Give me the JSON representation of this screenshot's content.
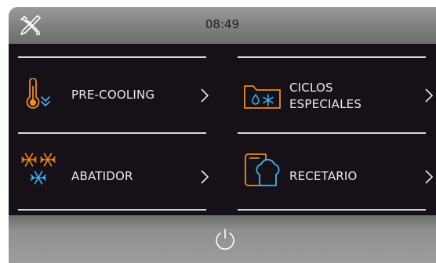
{
  "header": {
    "time": "08:49"
  },
  "menu": {
    "pre_cooling": "PRE-COOLING",
    "ciclos_line1": "CICLOS",
    "ciclos_line2": "ESPECIALES",
    "abatidor": "ABATIDOR",
    "recetario": "RECETARIO"
  },
  "icons": {
    "settings": "tools-icon",
    "pre_cooling": "thermometer-snow-icon",
    "ciclos": "folder-drop-snow-icon",
    "abatidor": "snowflakes-icon",
    "recetario": "chef-hat-book-icon",
    "chevron": "chevron-right-icon",
    "power": "power-icon"
  },
  "colors": {
    "accent_orange": "#f08a1c",
    "accent_blue": "#3fb4ee",
    "text": "#eaeaea",
    "background": "#161119",
    "bar": "#8c8c8c"
  }
}
